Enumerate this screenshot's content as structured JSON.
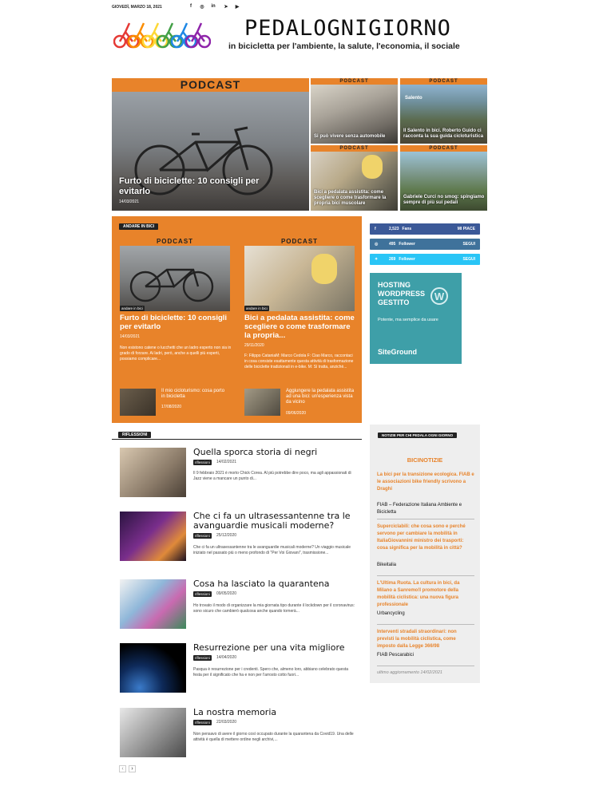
{
  "topbar": {
    "date": "GIOVEDÌ, MARZO 18, 2021",
    "social": [
      {
        "icon": "facebook-icon",
        "glyph": "f"
      },
      {
        "icon": "instagram-icon",
        "glyph": "◎"
      },
      {
        "icon": "linkedin-icon",
        "glyph": "in"
      },
      {
        "icon": "telegram-icon",
        "glyph": "➤"
      },
      {
        "icon": "youtube-icon",
        "glyph": "▶"
      }
    ]
  },
  "header": {
    "brand": "PEDALOGNIGIORNO",
    "tagline": "in bicicletta per l'ambiente, la salute, l'economia, il sociale"
  },
  "hero": {
    "main": {
      "badge": "PODCAST",
      "title": "Furto di biciclette: 10 consigli per evitarlo",
      "date": "14/03/2021"
    },
    "small": [
      {
        "badge": "PODCAST",
        "title": "Si può vivere senza automobile"
      },
      {
        "badge": "PODCAST",
        "overlay": "Salento",
        "title": "Il Salento in bici. Roberto Guido ci racconta la sua guida cicloturistica"
      },
      {
        "badge": "PODCAST",
        "title": "Bici a pedalata assistita: come scegliere o come trasformare la propria bici muscolare"
      },
      {
        "badge": "PODCAST",
        "title": "Gabriele Curci no smog: spingiamo sempre di più sui pedali"
      }
    ]
  },
  "andare": {
    "tag": "ANDARE IN BICI",
    "cards": [
      {
        "badge": "PODCAST",
        "cat": "andare in bici",
        "title": "Furto di biciclette: 10 consigli per evitarlo",
        "date": "14/03/2021",
        "excerpt": "Non esistono catene o lucchetti che un ladro esperto non sia in grado di forzare. Ai ladri, però, anche a quelli più esperti, possiamo complicare..."
      },
      {
        "badge": "PODCAST",
        "cat": "andare in bici",
        "title": "Bici a pedalata assistita: come scegliere o come trasformare la propria...",
        "date": "29/11/2020",
        "excerpt": "F: Filippo CataniaM: Marco Cedola F: Ciao Marco, raccontaci in cosa consiste esattamente questa attività di trasformazione delle biciclette tradizionali in e-bike. M: Sì tratta, anzichè..."
      }
    ],
    "small": [
      {
        "title": "Il mio cicloturismo: cosa porto in bicicletta",
        "date": "17/08/2020"
      },
      {
        "title": "Aggiungere la pedalata assistita ad una bici: un'esperienza vista da vicino",
        "date": "09/06/2020"
      }
    ]
  },
  "riflessioni": {
    "tag": "RIFLESSIONI",
    "items": [
      {
        "title": "Quella sporca storia di negri",
        "cat": "riflessioni",
        "date": "14/02/2021",
        "excerpt": "Il 9 febbraio 2021 è morto Chick Corea. Al più potrebbe dire poco, ma agli appassionati di Jazz viene a mancare un punto di..."
      },
      {
        "title": "Che ci fa un ultrasessantenne tra le avanguardie musicali moderne?",
        "cat": "riflessioni",
        "date": "25/12/2020",
        "excerpt": "Che ci fa un ultrasessantenne tra le avanguardie musicali moderne? Un viaggio musicale iniziato nel passato più o meno profondo di \"Per Voi Giovani\", trasmissione..."
      },
      {
        "title": "Cosa ha lasciato la quarantena",
        "cat": "riflessioni",
        "date": "09/05/2020",
        "excerpt": "Ho trovato il modo di organizzare la mia giornata tipo durante il lockdown per il coronavirus: sono sicuro che cambierò qualcosa anche quando tornerà..."
      },
      {
        "title": "Resurrezione per una vita migliore",
        "cat": "riflessioni",
        "date": "14/04/2020",
        "excerpt": "Pasqua è resurrezione per i credenti. Spero che, almeno loro, abbiano celebrato questa festa per il significato che ha e non per l'arrosto cotto fuori..."
      },
      {
        "title": "La nostra memoria",
        "cat": "riflessioni",
        "date": "22/03/2020",
        "excerpt": "Non pensavo di avere il giorno così occupato durante la quarantena da Covid19. Una delle attività è quella di mettere ordine negli archivi,..."
      }
    ],
    "pager": [
      "‹",
      "›"
    ]
  },
  "sidebar": {
    "social": [
      {
        "icon": "facebook-icon",
        "glyph": "f",
        "count": "2,523",
        "unit": "Fans",
        "action": "MI PIACE",
        "color": "#3b5998"
      },
      {
        "icon": "instagram-icon",
        "glyph": "◎",
        "count": "495",
        "unit": "Follower",
        "action": "SEGUI",
        "color": "#3f729b"
      },
      {
        "icon": "twitter-icon",
        "glyph": "✦",
        "count": "269",
        "unit": "Follower",
        "action": "SEGUI",
        "color": "#29c5f6"
      }
    ],
    "ad": {
      "line1": "HOSTING",
      "line2": "WORDPRESS",
      "line3": "GESTITO",
      "sub": "Potente, ma semplice da usare",
      "brand": "SiteGround"
    },
    "notizie": {
      "tag": "NOTIZIE PER CHI PEDALA OGNI GIORNO",
      "title": "BICINOTIZIE",
      "items": [
        {
          "link": "La bici per la transizione ecologica. FIAB e le associazioni bike friendly scrivono a Draghi",
          "source": "FIAB – Federazione Italiana Ambiente e Bicicletta"
        },
        {
          "link": "Superciclabili: che cosa sono e perché servono per cambiare la mobilità in ItaliaGiovannini ministro dei trasporti: cosa significa per la mobilità in città?",
          "source": "Bikeitalia"
        },
        {
          "link": "L'Ultima Ruota. La cultura in bici, da Milano a Sanremo!l promotore della mobilità ciclistica: una nuova figura professionale",
          "source": "Urbancycling"
        },
        {
          "link": "Interventi stradali straordinari: non previsti la mobilità ciclistica, come imposto dalla Legge 366/98",
          "source": "FIAB Pescarabici"
        }
      ],
      "updated": "ultimo aggiornamento 14/02/2021"
    }
  },
  "colors": {
    "accent": "#e8832a",
    "dark": "#222222"
  }
}
